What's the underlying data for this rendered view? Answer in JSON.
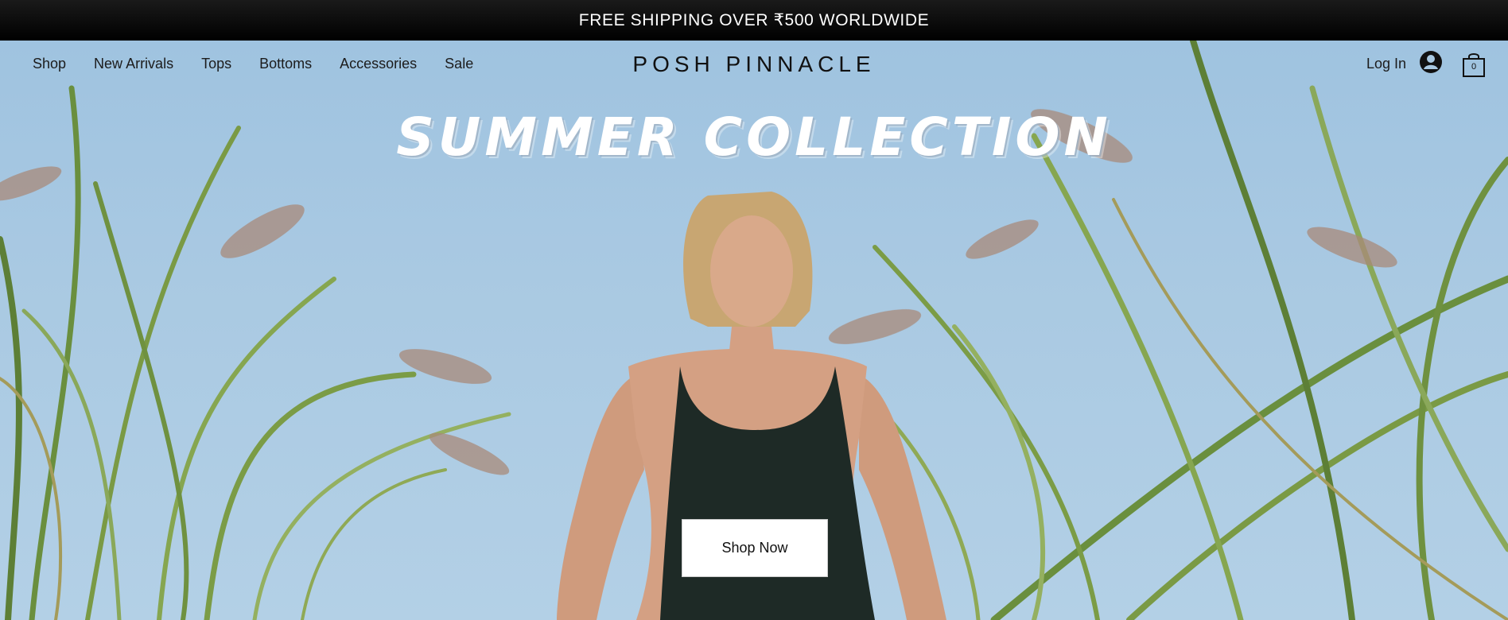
{
  "promo": {
    "text": "FREE SHIPPING OVER ₹500 WORLDWIDE"
  },
  "nav": {
    "links": [
      "Shop",
      "New Arrivals",
      "Tops",
      "Bottoms",
      "Accessories",
      "Sale"
    ],
    "brand": "POSH PINNACLE",
    "login_label": "Log In",
    "cart_count": "0",
    "icons": {
      "account": "user-avatar-icon",
      "cart": "shopping-bag-icon"
    }
  },
  "hero": {
    "headline": "SUMMER COLLECTION",
    "cta_label": "Shop Now"
  },
  "colors": {
    "promo_bg": "#000000",
    "sky": "#a9c9e2",
    "grass": "#5f8a3a",
    "text": "#111111"
  }
}
